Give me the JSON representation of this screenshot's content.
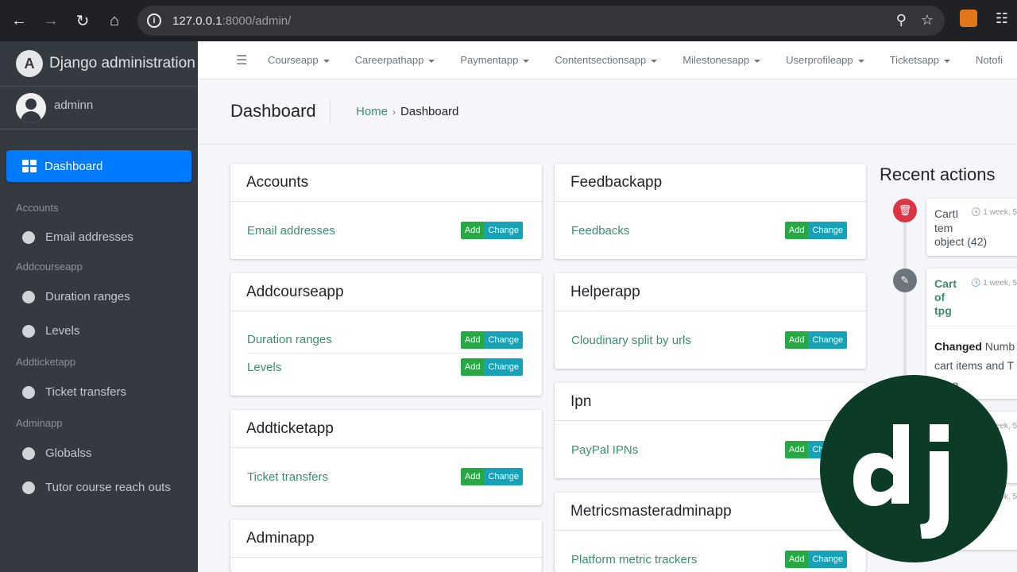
{
  "browser": {
    "url_host": "127.0.0.1",
    "url_rest": ":8000/admin/"
  },
  "sidebar": {
    "brand": "Django administration",
    "user": "adminn",
    "active": "Dashboard",
    "groups": [
      {
        "header": "Accounts",
        "items": [
          "Email addresses"
        ]
      },
      {
        "header": "Addcourseapp",
        "items": [
          "Duration ranges",
          "Levels"
        ]
      },
      {
        "header": "Addticketapp",
        "items": [
          "Ticket transfers"
        ]
      },
      {
        "header": "Adminapp",
        "items": [
          "Globalss",
          "Tutor course reach outs"
        ]
      }
    ]
  },
  "topnav": [
    "Courseapp",
    "Careerpathapp",
    "Paymentapp",
    "Contentsectionsapp",
    "Milestonesapp",
    "Userprofileapp",
    "Ticketsapp",
    "Notofi"
  ],
  "header": {
    "title": "Dashboard",
    "breadcrumb_home": "Home",
    "breadcrumb_sep": "›",
    "breadcrumb_current": "Dashboard"
  },
  "buttons": {
    "add": "Add",
    "change": "Change"
  },
  "apps": {
    "accounts": {
      "title": "Accounts",
      "models": [
        "Email addresses"
      ]
    },
    "addcourseapp": {
      "title": "Addcourseapp",
      "models": [
        "Duration ranges",
        "Levels"
      ]
    },
    "addticketapp": {
      "title": "Addticketapp",
      "models": [
        "Ticket transfers"
      ]
    },
    "adminapp": {
      "title": "Adminapp"
    },
    "feedbackapp": {
      "title": "Feedbackapp",
      "models": [
        "Feedbacks"
      ]
    },
    "helperapp": {
      "title": "Helperapp",
      "models": [
        "Cloudinary split by urls"
      ]
    },
    "ipn": {
      "title": "Ipn",
      "models": [
        "PayPal IPNs"
      ]
    },
    "metrics": {
      "title": "Metricsmasteradminapp",
      "models": [
        "Platform metric trackers"
      ]
    }
  },
  "recent": {
    "title": "Recent actions",
    "items": [
      {
        "line1": "CartI",
        "line2": "tem",
        "line3": "object (42)",
        "time": "1 week, 5"
      },
      {
        "link1": "Cart",
        "link2": "of",
        "link3": "tpg",
        "time": "1 week, 5",
        "changed": "Changed",
        "changed_rest": "Numb",
        "line2": "cart items and T",
        "line3": "price."
      }
    ],
    "time3": "1 week, 5",
    "time4": "1 week, 5"
  },
  "colors": {
    "accent": "#007bff",
    "link": "#3d8c6e",
    "add": "#28a745",
    "change": "#17a2b8",
    "django": "#0c3c26"
  }
}
